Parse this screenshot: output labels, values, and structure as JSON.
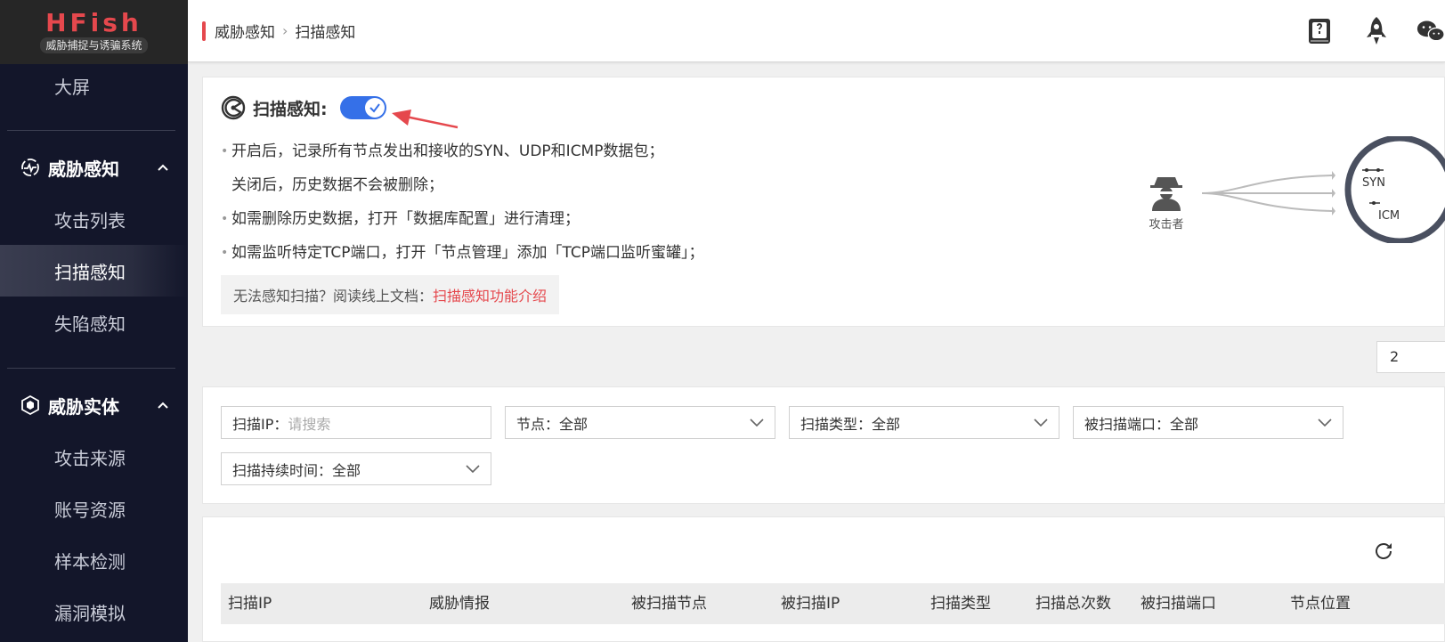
{
  "brand": {
    "name": "HFish",
    "subtitle": "威胁捕捉与诱骗系统"
  },
  "sidebar": {
    "top_item": "大屏",
    "groups": [
      {
        "label": "威胁感知",
        "items": [
          "攻击列表",
          "扫描感知",
          "失陷感知"
        ],
        "active": "扫描感知"
      },
      {
        "label": "威胁实体",
        "items": [
          "攻击来源",
          "账号资源",
          "样本检测",
          "漏洞模拟"
        ]
      }
    ]
  },
  "header": {
    "breadcrumb": [
      "威胁感知",
      "扫描感知"
    ],
    "icons": [
      "book-icon",
      "rocket-icon",
      "wechat-icon"
    ]
  },
  "scan": {
    "title": "扫描感知:",
    "toggle_on": true,
    "lines": [
      "开启后，记录所有节点发出和接收的SYN、UDP和ICMP数据包；",
      "关闭后，历史数据不会被删除；",
      "如需删除历史数据，打开「数据库配置」进行清理；",
      "如需监听特定TCP端口，打开「节点管理」添加「TCP端口监听蜜罐」；"
    ],
    "doc_prefix": "无法感知扫描？阅读线上文档：",
    "doc_link": "扫描感知功能介绍",
    "attacker_label": "攻击者",
    "globe_labels": [
      "SYN",
      "ICM"
    ]
  },
  "page_size_partial": "2",
  "filters": {
    "scan_ip": {
      "label": "扫描IP：",
      "placeholder": "请搜索"
    },
    "node": {
      "label": "节点：",
      "value": "全部"
    },
    "scan_type": {
      "label": "扫描类型：",
      "value": "全部"
    },
    "scanned_port": {
      "label": "被扫描端口：",
      "value": "全部"
    },
    "duration": {
      "label": "扫描持续时间：",
      "value": "全部"
    }
  },
  "table": {
    "columns": [
      "扫描IP",
      "威胁情报",
      "被扫描节点",
      "被扫描IP",
      "扫描类型",
      "扫描总次数",
      "被扫描端口",
      "节点位置"
    ]
  },
  "colors": {
    "accent": "#e5484d",
    "toggle": "#3570e8",
    "sidebar_bg": "#13162a"
  }
}
